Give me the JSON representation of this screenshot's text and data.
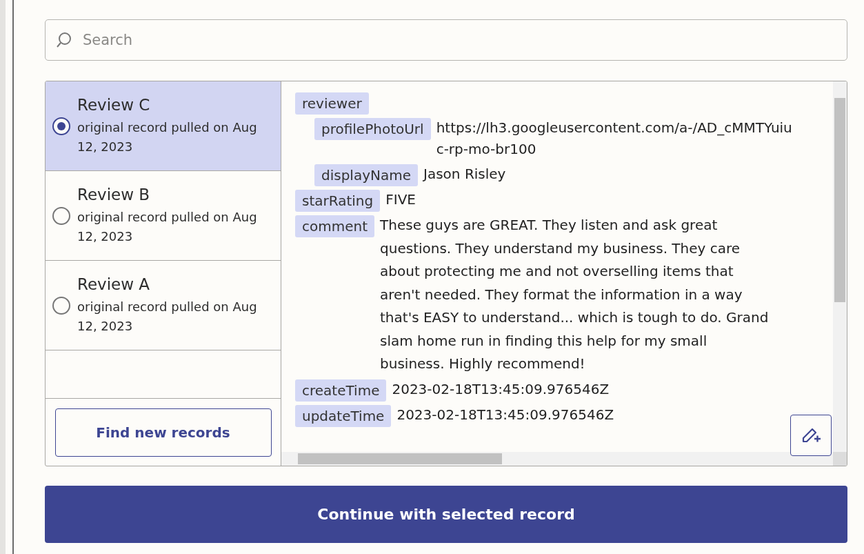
{
  "search": {
    "placeholder": "Search"
  },
  "records": [
    {
      "title": "Review C",
      "subtitle": "original record pulled on Aug 12, 2023",
      "selected": true
    },
    {
      "title": "Review B",
      "subtitle": "original record pulled on Aug 12, 2023",
      "selected": false
    },
    {
      "title": "Review A",
      "subtitle": "original record pulled on Aug 12, 2023",
      "selected": false
    }
  ],
  "find_button": "Find new records",
  "fields": [
    {
      "key": "reviewer",
      "children": [
        {
          "key": "profilePhotoUrl",
          "value_lines": [
            "https://lh3.googleusercontent.com/a-/AD_cMMTYuiu",
            "c-rp-mo-br100"
          ]
        },
        {
          "key": "displayName",
          "value": "Jason Risley"
        }
      ]
    },
    {
      "key": "starRating",
      "value": "FIVE"
    },
    {
      "key": "comment",
      "value": "These guys are GREAT.  They listen and ask great questions.  They understand my business.  They care about protecting me and not overselling items that aren't needed.  They format the information in a way that's EASY to understand... which is tough to do.  Grand slam home run in finding this help for my small business.  Highly recommend!"
    },
    {
      "key": "createTime",
      "value": "2023-02-18T13:45:09.976546Z"
    },
    {
      "key": "updateTime",
      "value": "2023-02-18T13:45:09.976546Z"
    }
  ],
  "continue_button": "Continue with selected record"
}
